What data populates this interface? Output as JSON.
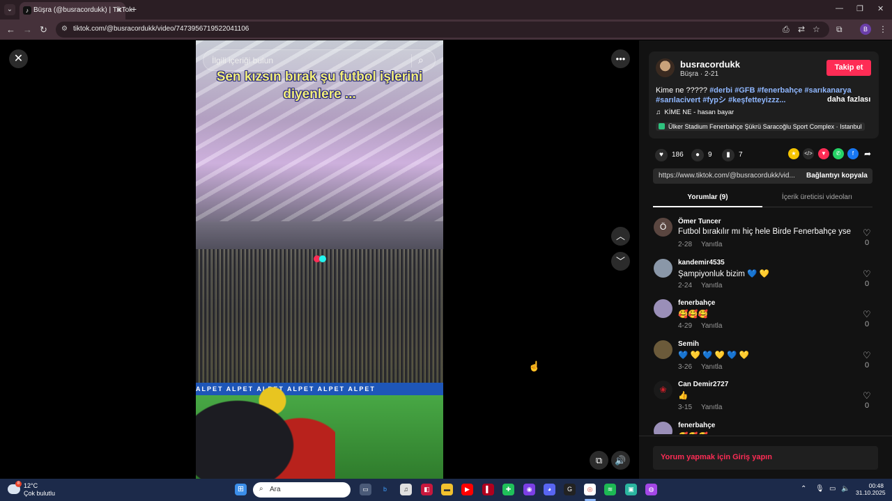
{
  "browser": {
    "tab_title": "Büşra (@busracordukk) | TikTok",
    "tab_close": "✕",
    "new_tab": "+",
    "url": "tiktok.com/@busracordukk/video/7473956719522041106"
  },
  "video": {
    "search_placeholder": "İlgili içeriği bulun",
    "caption": "Sen kızsın bırak şu futbol işlerini diyenlere ...",
    "adboard_text": "ALPET  ALPET  ALPET  ALPET  ALPET  ALPET"
  },
  "author": {
    "username": "busracordukk",
    "subtitle": "Büşra · 2-21",
    "follow_label": "Takip et",
    "description_prefix": "Kime ne ????? ",
    "description_tags": "#derbi #GFB #fenerbahçe #sarıkanarya #sarılacivert #fypシ #keşfetteyizzz...",
    "more_label": "daha fazlası",
    "music": "KİME NE - hasan bayar",
    "location": "Ülker Stadium Fenerbahçe Şükrü Saracoğlu Sport Complex · Istanbul"
  },
  "stats": {
    "likes": "186",
    "comments": "9",
    "saves": "7"
  },
  "link": {
    "url": "https://www.tiktok.com/@busracordukk/vid...",
    "copy_label": "Bağlantıyı kopyala"
  },
  "tabs": {
    "comments": "Yorumlar (9)",
    "creator_videos": "İçerik üreticisi videoları"
  },
  "comments": [
    {
      "avatar": "Ö",
      "user": "Ömer Tuncer",
      "text": "Futbol bırakılır mı hiç hele Birde Fenerbahçe yse",
      "date": "2-28",
      "reply": "Yanıtla",
      "likes": "0"
    },
    {
      "avatar": "",
      "user": "kandemir4535",
      "text": "Şampiyonluk bizim 💙 💛",
      "date": "2-24",
      "reply": "Yanıtla",
      "likes": "0"
    },
    {
      "avatar": "",
      "user": "fenerbahçe",
      "text": "🥰🥰🥰",
      "date": "4-29",
      "reply": "Yanıtla",
      "likes": "0"
    },
    {
      "avatar": "",
      "user": "Semih",
      "text": "💙 💛 💙 💛 💙 💛",
      "date": "3-26",
      "reply": "Yanıtla",
      "likes": "0"
    },
    {
      "avatar": "",
      "user": "Can Demir2727",
      "text": "👍",
      "date": "3-15",
      "reply": "Yanıtla",
      "likes": "0"
    },
    {
      "avatar": "",
      "user": "fenerbahçe",
      "text": "🥰🥰🥰",
      "date": "",
      "reply": "",
      "likes": ""
    }
  ],
  "login_prompt": "Yorum yapmak için Giriş yapın",
  "taskbar": {
    "weather_badge": "8",
    "temperature": "12°C",
    "weather_desc": "Çok bulutlu",
    "search_placeholder": "Ara",
    "time": "00:48",
    "date": "31.10.2025"
  },
  "colors": {
    "accent": "#fe2c55",
    "tag": "#8fb7ff",
    "panel_bg": "#121212",
    "taskbar_bg": "#1c2a4a"
  }
}
